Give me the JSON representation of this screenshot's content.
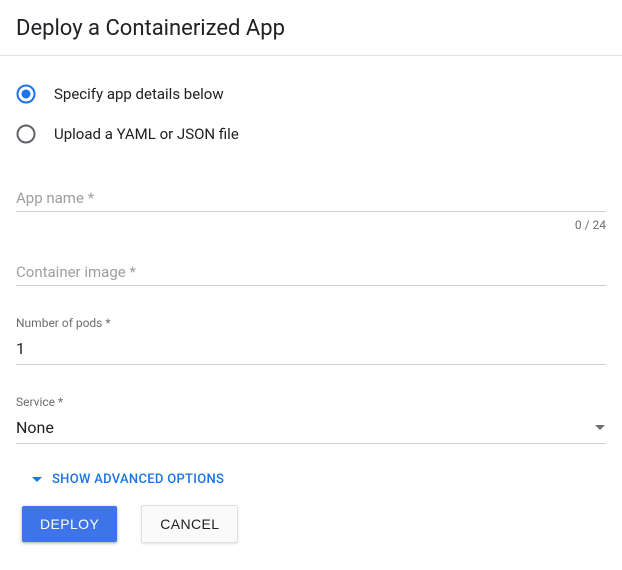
{
  "title": "Deploy a Containerized App",
  "radios": {
    "specify": {
      "label": "Specify app details below",
      "selected": true
    },
    "upload": {
      "label": "Upload a YAML or JSON file",
      "selected": false
    }
  },
  "fields": {
    "appName": {
      "placeholder": "App name *",
      "value": "",
      "counter": "0 / 24"
    },
    "containerImage": {
      "placeholder": "Container image *",
      "value": ""
    },
    "pods": {
      "label": "Number of pods *",
      "value": "1"
    },
    "service": {
      "label": "Service *",
      "value": "None"
    }
  },
  "advanced": {
    "label": "SHOW ADVANCED OPTIONS"
  },
  "actions": {
    "deploy": "DEPLOY",
    "cancel": "CANCEL"
  },
  "colors": {
    "accent": "#1a73e8",
    "primaryBtn": "#3f73e8"
  }
}
